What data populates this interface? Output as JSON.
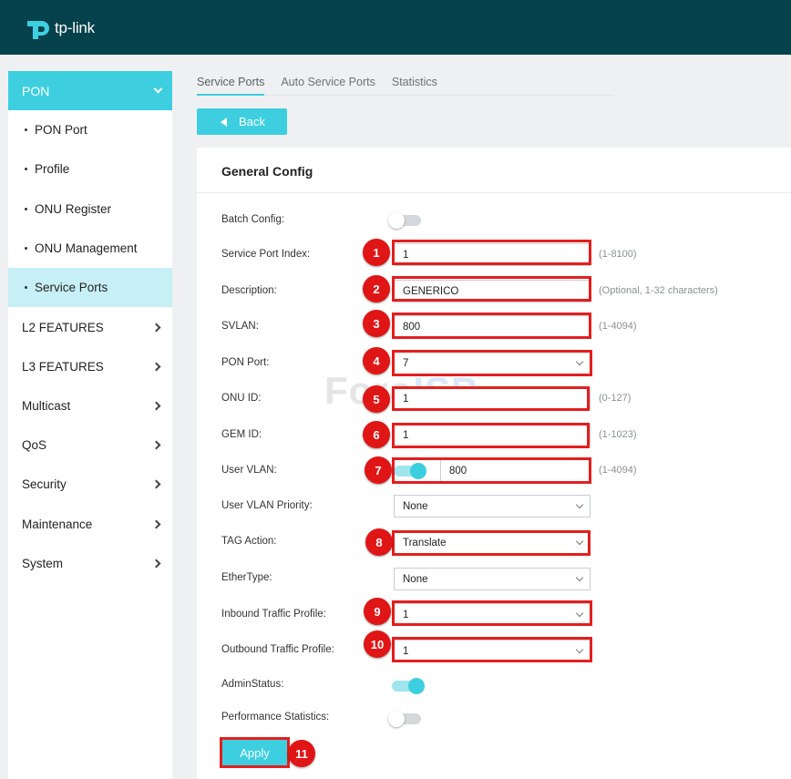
{
  "app": {
    "logo_text": "tp-link",
    "accent_color": "#3dcfe0",
    "header_color": "#06424c",
    "highlight_color": "#e41e1e"
  },
  "sidebar": {
    "section": "PON",
    "sub_items": [
      {
        "label": "PON Port",
        "active": false
      },
      {
        "label": "Profile",
        "active": false
      },
      {
        "label": "ONU Register",
        "active": false
      },
      {
        "label": "ONU Management",
        "active": false
      },
      {
        "label": "Service Ports",
        "active": true
      }
    ],
    "items": [
      {
        "label": "L2 FEATURES"
      },
      {
        "label": "L3 FEATURES"
      },
      {
        "label": "Multicast"
      },
      {
        "label": "QoS"
      },
      {
        "label": "Security"
      },
      {
        "label": "Maintenance"
      },
      {
        "label": "System"
      }
    ]
  },
  "tabs": [
    {
      "label": "Service Ports",
      "active": true
    },
    {
      "label": "Auto Service Ports",
      "active": false
    },
    {
      "label": "Statistics",
      "active": false
    }
  ],
  "back_label": "Back",
  "panel_title": "General Config",
  "watermark": {
    "part1": "Foro",
    "part2": "ISP"
  },
  "form": {
    "batch_config": {
      "label": "Batch Config:",
      "on": false
    },
    "service_port_index": {
      "label": "Service Port Index:",
      "value": "1",
      "hint": "(1-8100)",
      "badge": "1"
    },
    "description": {
      "label": "Description:",
      "value": "GENERICO",
      "hint": "(Optional, 1-32 characters)",
      "badge": "2"
    },
    "svlan": {
      "label": "SVLAN:",
      "value": "800",
      "hint": "(1-4094)",
      "badge": "3"
    },
    "pon_port": {
      "label": "PON Port:",
      "value": "7",
      "badge": "4"
    },
    "onu_id": {
      "label": "ONU ID:",
      "value": "1",
      "hint": "(0-127)",
      "badge": "5"
    },
    "gem_id": {
      "label": "GEM ID:",
      "value": "1",
      "hint": "(1-1023)",
      "badge": "6"
    },
    "user_vlan": {
      "label": "User VLAN:",
      "value": "800",
      "hint": "(1-4094)",
      "badge": "7",
      "on": true
    },
    "user_vlan_priority": {
      "label": "User VLAN Priority:",
      "value": "None"
    },
    "tag_action": {
      "label": "TAG Action:",
      "value": "Translate",
      "badge": "8"
    },
    "ether_type": {
      "label": "EtherType:",
      "value": "None"
    },
    "inbound_profile": {
      "label": "Inbound Traffic Profile:",
      "value": "1",
      "badge": "9"
    },
    "outbound_profile": {
      "label": "Outbound Traffic Profile:",
      "value": "1",
      "badge": "10"
    },
    "admin_status": {
      "label": "AdminStatus:",
      "on": true
    },
    "performance_statistics": {
      "label": "Performance Statistics:",
      "on": false
    }
  },
  "apply": {
    "label": "Apply",
    "badge": "11"
  }
}
